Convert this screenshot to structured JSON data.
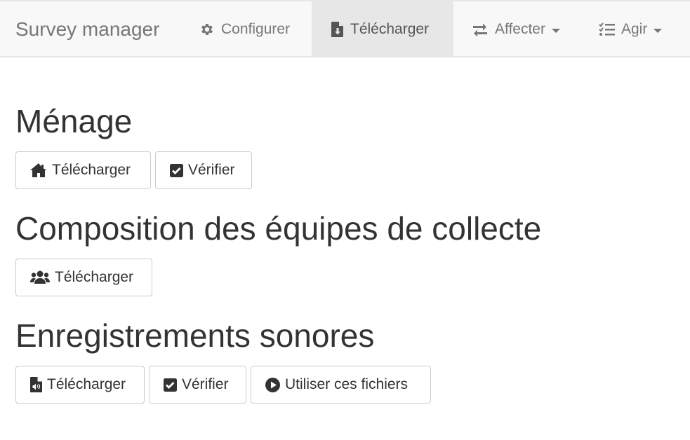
{
  "navbar": {
    "brand": "Survey manager",
    "items": [
      {
        "label": "Configurer",
        "icon": "gear-icon",
        "active": false,
        "dropdown": false
      },
      {
        "label": "Télécharger",
        "icon": "file-download-icon",
        "active": true,
        "dropdown": false
      },
      {
        "label": "Affecter",
        "icon": "exchange-arrows-icon",
        "active": false,
        "dropdown": true
      },
      {
        "label": "Agir",
        "icon": "task-list-icon",
        "active": false,
        "dropdown": true
      }
    ]
  },
  "sections": [
    {
      "title": "Ménage",
      "buttons": [
        {
          "label": "Télécharger",
          "icon": "home-icon"
        },
        {
          "label": "Vérifier",
          "icon": "checkbox-checked-icon"
        }
      ]
    },
    {
      "title": "Composition des équipes de collecte",
      "buttons": [
        {
          "label": "Télécharger",
          "icon": "users-icon"
        }
      ]
    },
    {
      "title": "Enregistrements sonores",
      "buttons": [
        {
          "label": "Télécharger",
          "icon": "file-audio-icon"
        },
        {
          "label": "Vérifier",
          "icon": "checkbox-checked-icon"
        },
        {
          "label": "Utiliser ces fichiers",
          "icon": "play-circle-icon"
        }
      ]
    }
  ],
  "colors": {
    "navbar_bg": "#f8f8f8",
    "navbar_active_bg": "#e7e7e7",
    "nav_text": "#777777",
    "text": "#333333",
    "button_border": "#cccccc"
  }
}
